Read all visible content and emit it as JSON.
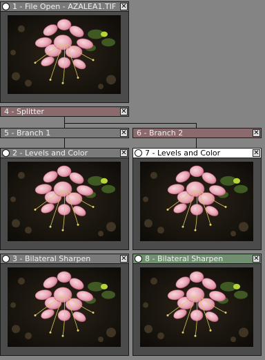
{
  "colors": {
    "title_gray": "#7a7a7a",
    "title_rose": "#8a6a6c",
    "title_white": "#ffffff",
    "title_green": "#6f8f70"
  },
  "nodes": {
    "file_open": {
      "title": "1 - File Open - AZALEA1.TIF",
      "thumbnail": "azalea-flower"
    },
    "splitter": {
      "title": "4 - Splitter"
    },
    "branch1": {
      "title": "5 - Branch 1"
    },
    "branch2": {
      "title": "6 - Branch 2"
    },
    "levels_left": {
      "title": "2 - Levels and Color",
      "thumbnail": "azalea-flower"
    },
    "levels_right": {
      "title": "7 - Levels and Color",
      "thumbnail": "azalea-flower"
    },
    "sharpen_left": {
      "title": "3 - Bilateral Sharpen",
      "thumbnail": "azalea-flower"
    },
    "sharpen_right": {
      "title": "8 - Bilateral Sharpen",
      "thumbnail": "azalea-flower"
    }
  },
  "icons": {
    "close": "close-icon",
    "radio": "radio-icon"
  },
  "close_glyph": "✕"
}
